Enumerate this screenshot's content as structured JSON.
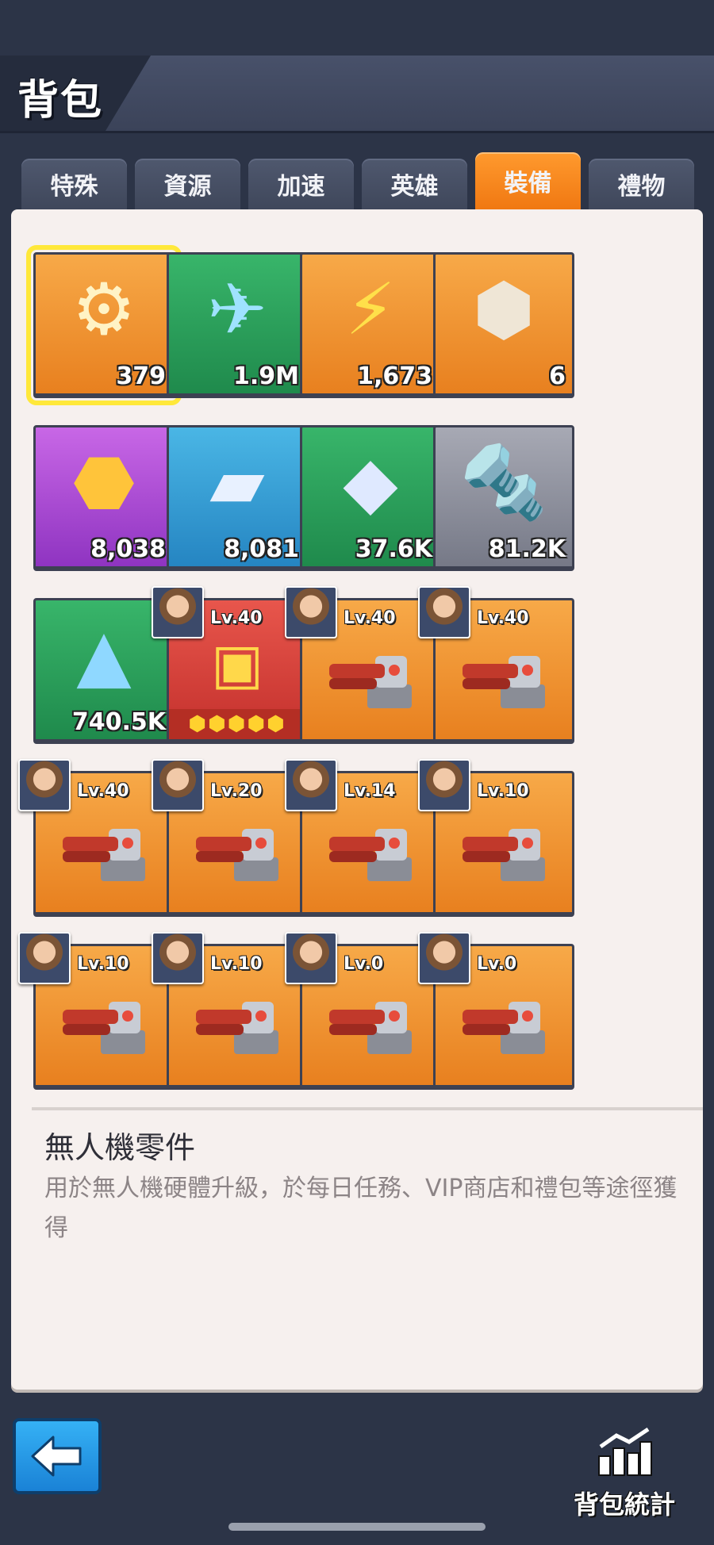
{
  "header": {
    "title": "背包"
  },
  "tabs": [
    {
      "label": "特殊",
      "active": false
    },
    {
      "label": "資源",
      "active": false
    },
    {
      "label": "加速",
      "active": false
    },
    {
      "label": "英雄",
      "active": false
    },
    {
      "label": "裝備",
      "active": true
    },
    {
      "label": "禮物",
      "active": false
    }
  ],
  "items": [
    {
      "count": "379",
      "color": "orange",
      "icon": "gear-icon",
      "selected": true
    },
    {
      "count": "1.9M",
      "color": "green",
      "icon": "drone-chip-icon"
    },
    {
      "count": "1,673",
      "color": "orange",
      "icon": "energy-plate-icon"
    },
    {
      "count": "6",
      "color": "orange",
      "icon": "armor-part-icon"
    },
    {
      "count": "8,038",
      "color": "purple",
      "icon": "honeycomb-icon"
    },
    {
      "count": "8,081",
      "color": "blue",
      "icon": "ingot-icon"
    },
    {
      "count": "37.6K",
      "color": "green",
      "icon": "ice-block-icon"
    },
    {
      "count": "81.2K",
      "color": "gray",
      "icon": "bolt-icon"
    },
    {
      "count": "740.5K",
      "color": "green",
      "icon": "crystal-icon"
    }
  ],
  "equipment": [
    {
      "level": "Lv.40",
      "color": "red",
      "stars": 5
    },
    {
      "level": "Lv.40",
      "color": "orange"
    },
    {
      "level": "Lv.40",
      "color": "orange"
    },
    {
      "level": "Lv.40",
      "color": "orange"
    },
    {
      "level": "Lv.20",
      "color": "orange"
    },
    {
      "level": "Lv.14",
      "color": "orange"
    },
    {
      "level": "Lv.10",
      "color": "orange"
    },
    {
      "level": "Lv.10",
      "color": "orange"
    },
    {
      "level": "Lv.10",
      "color": "orange"
    },
    {
      "level": "Lv.0",
      "color": "orange"
    },
    {
      "level": "Lv.0",
      "color": "orange"
    }
  ],
  "description": {
    "title": "無人機零件",
    "text": "用於無人機硬體升級，於每日任務、VIP商店和禮包等途徑獲得"
  },
  "footer": {
    "stats_label": "背包統計"
  },
  "colors": {
    "accent": "#f07812",
    "panel": "#f6f0ee",
    "background": "#2c3447"
  }
}
